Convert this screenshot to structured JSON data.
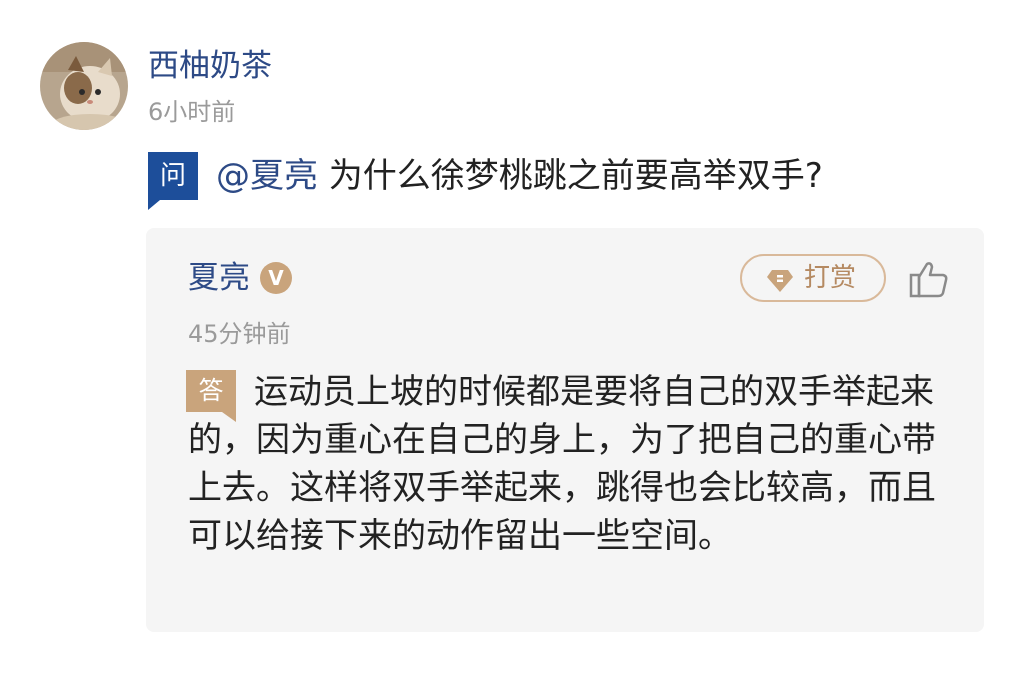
{
  "question_card": {
    "asker": {
      "name": "西柚奶茶",
      "time": "6小时前"
    },
    "question": {
      "badge": "问",
      "mention": "@夏亮",
      "text": " 为什么徐梦桃跳之前要高举双手?"
    }
  },
  "answer_card": {
    "answerer": {
      "name": "夏亮",
      "verified_badge": "V",
      "time": "45分钟前"
    },
    "tip_button": {
      "label": "打赏",
      "icon": "gem-icon"
    },
    "like_button": {
      "icon": "thumbs-up-icon"
    },
    "answer": {
      "badge": "答",
      "text": "运动员上坡的时候都是要将自己的双手举起来的，因为重心在自己的身上，为了把自己的重心带上去。这样将双手举起来，跳得也会比较高，而且可以给接下来的动作留出一些空间。"
    }
  },
  "colors": {
    "link_blue": "#2d4a86",
    "question_badge": "#1d4e9a",
    "answer_badge": "#c9a47c",
    "tip_accent": "#b58a62",
    "card_background": "#f5f5f5",
    "muted_text": "#9a9a9a"
  }
}
